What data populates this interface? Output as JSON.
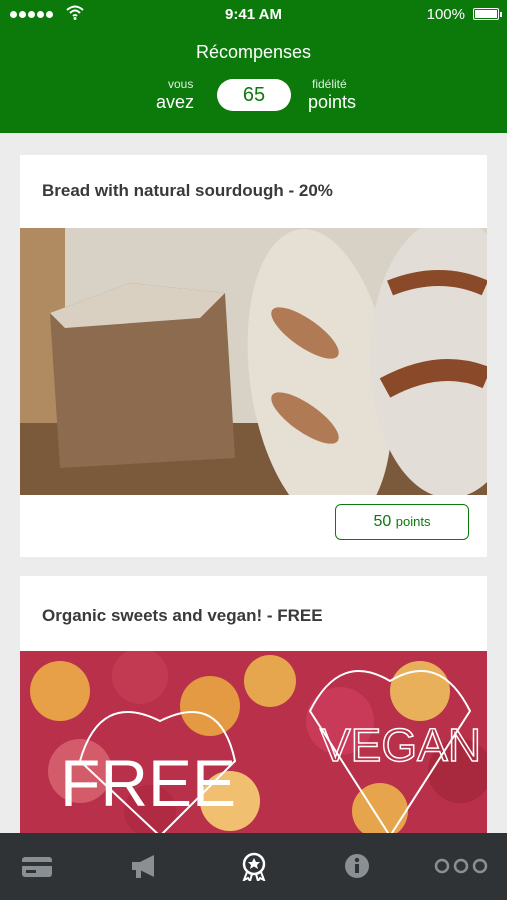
{
  "status_bar": {
    "time": "9:41 AM",
    "battery": "100%"
  },
  "header": {
    "title": "Récompenses",
    "left_small": "vous",
    "left_big": "avez",
    "points": "65",
    "right_small": "fidélité",
    "right_big": "points"
  },
  "rewards": [
    {
      "title": "Bread with natural sourdough - 20%",
      "points_value": "50",
      "points_unit": "points"
    },
    {
      "title": "Organic sweets and vegan! - FREE",
      "image_text_1": "FREE",
      "image_text_2": "VEGAN"
    }
  ],
  "tabs": [
    {
      "icon": "card-icon",
      "active": false
    },
    {
      "icon": "megaphone-icon",
      "active": false
    },
    {
      "icon": "award-icon",
      "active": true
    },
    {
      "icon": "info-icon",
      "active": false
    },
    {
      "icon": "more-icon",
      "active": false
    }
  ],
  "colors": {
    "brand": "#0b7a0b",
    "tabbar": "#2f3336",
    "tab_icon": "#8a8f93",
    "tab_icon_active": "#ffffff"
  }
}
